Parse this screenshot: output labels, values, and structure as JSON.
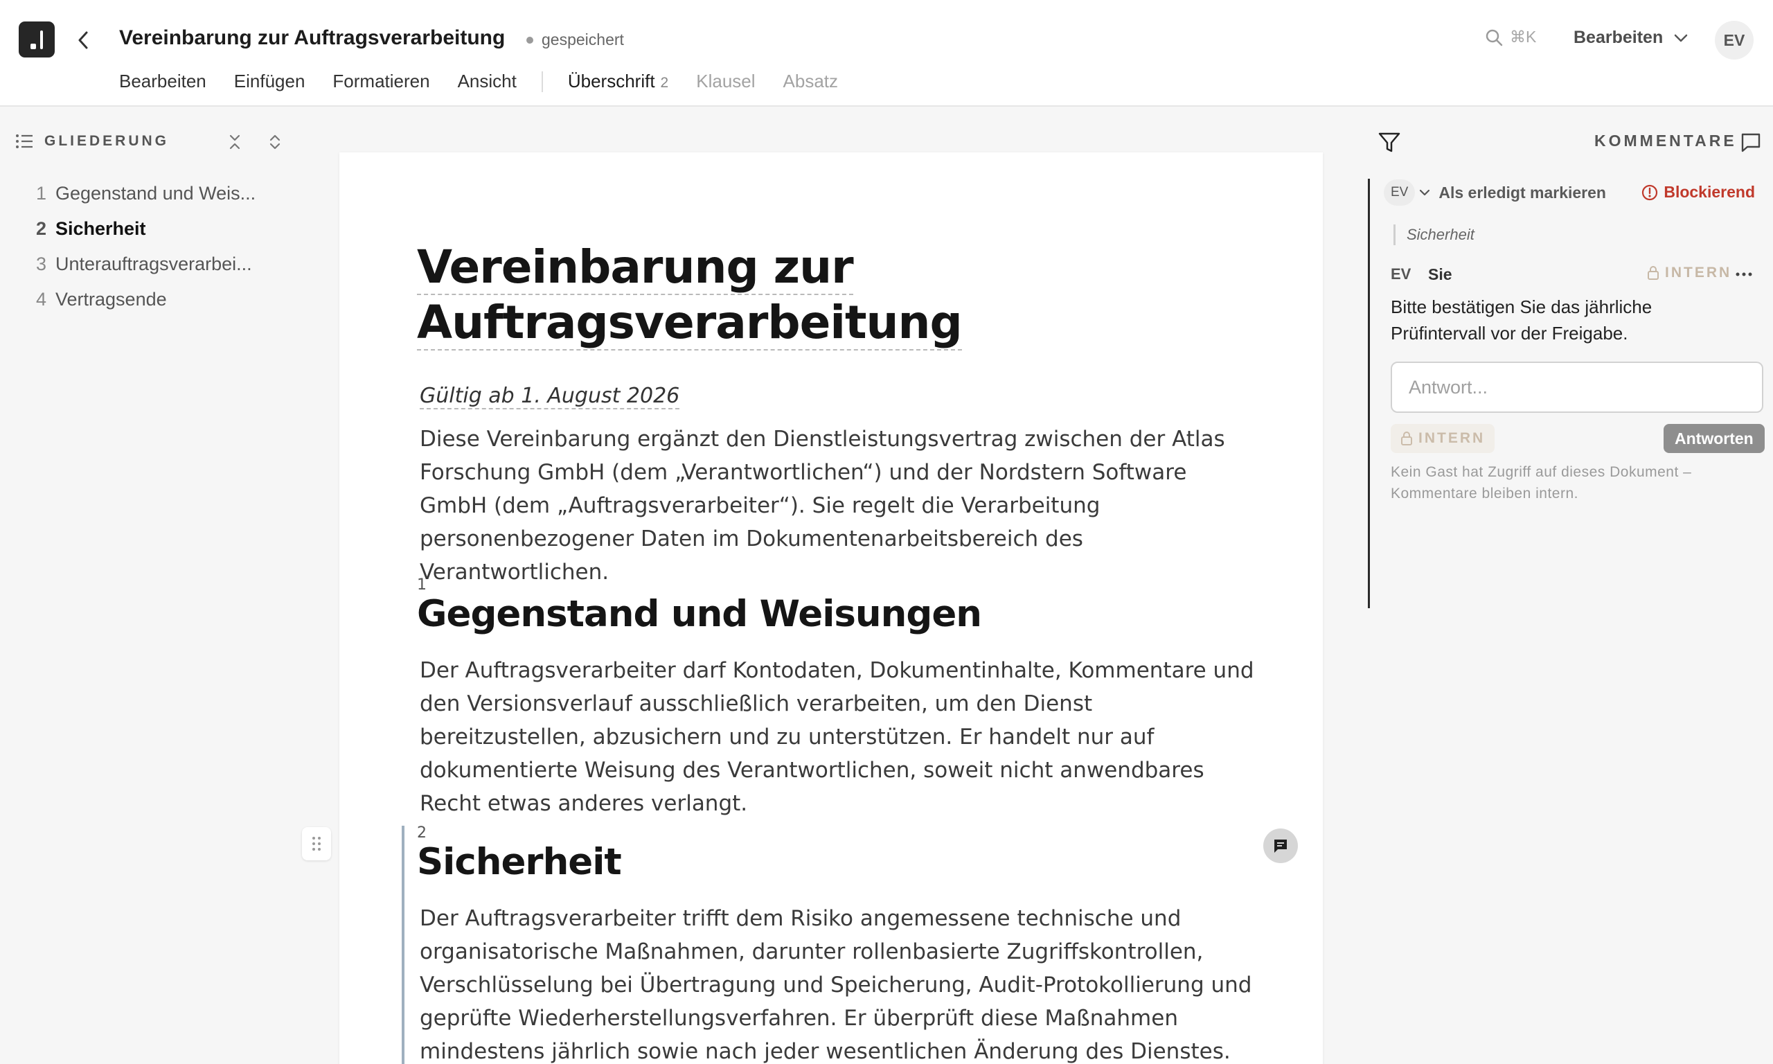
{
  "header": {
    "doc_title": "Vereinbarung zur Auftragsverarbeitung",
    "saved_status": "gespeichert",
    "search_shortcut": "⌘K",
    "mode_label": "Bearbeiten",
    "avatar_initials": "EV"
  },
  "menubar": {
    "items": [
      "Bearbeiten",
      "Einfügen",
      "Formatieren",
      "Ansicht"
    ],
    "context": {
      "heading_label": "Überschrift",
      "heading_level": "2",
      "clause_label": "Klausel",
      "paragraph_label": "Absatz"
    }
  },
  "outline": {
    "title": "GLIEDERUNG",
    "items": [
      {
        "num": "1",
        "label": "Gegenstand und Weis..."
      },
      {
        "num": "2",
        "label": "Sicherheit"
      },
      {
        "num": "3",
        "label": "Unterauftragsverarbei..."
      },
      {
        "num": "4",
        "label": "Vertragsende"
      }
    ]
  },
  "document": {
    "title_line1": "Vereinbarung zur",
    "title_line2": "Auftragsverarbeitung",
    "valid_from": "Gültig ab 1. August 2026",
    "intro": "Diese Vereinbarung ergänzt den Dienstleistungsvertrag zwischen der Atlas Forschung GmbH (dem „Verantwortlichen“) und der Nordstern Software GmbH (dem „Auftragsverarbeiter“). Sie regelt die Verarbeitung personenbezogener Daten im Dokumentenarbeitsbereich des Verantwortlichen.",
    "sections": [
      {
        "num": "1",
        "heading": "Gegenstand und Weisungen",
        "body": "Der Auftragsverarbeiter darf Kontodaten, Dokumentinhalte, Kommentare und den Versionsverlauf ausschließlich verarbeiten, um den Dienst bereitzustellen, abzusichern und zu unterstützen. Er handelt nur auf dokumentierte Weisung des Verantwortlichen, soweit nicht anwendbares Recht etwas anderes verlangt."
      },
      {
        "num": "2",
        "heading": "Sicherheit",
        "body": "Der Auftragsverarbeiter trifft dem Risiko angemessene technische und organisatorische Maßnahmen, darunter rollenbasierte Zugriffskontrollen, Verschlüsselung bei Übertragung und Speicherung, Audit-Protokollierung und geprüfte Wiederherstellungsverfahren. Er überprüft diese Maßnahmen mindestens jährlich sowie nach jeder wesentlichen Änderung des Dienstes."
      }
    ]
  },
  "comments": {
    "title": "KOMMENTARE",
    "thread": {
      "assignee_initials": "EV",
      "resolve_label": "Als erledigt markieren",
      "blocking_label": "Blockierend",
      "quote": "Sicherheit",
      "author_initials": "EV",
      "author_name": "Sie",
      "visibility_label": "INTERN",
      "body": "Bitte bestätigen Sie das jährliche Prüfintervall vor der Freigabe.",
      "reply_placeholder": "Antwort...",
      "reply_visibility": "INTERN",
      "reply_button": "Antworten",
      "notice": "Kein Gast hat Zugriff auf dieses Dokument – Kommentare bleiben intern."
    }
  },
  "colors": {
    "accent_dark": "#262626",
    "blocking_red": "#c0392b",
    "intern_beige": "#c7b8a6",
    "section_bar": "#9fb0bf"
  }
}
